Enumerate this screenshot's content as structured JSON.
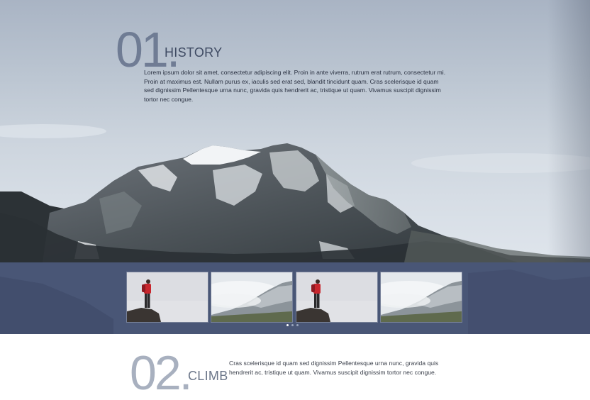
{
  "history": {
    "number": "01.",
    "title": "HISTORY",
    "text": "Lorem ipsum dolor sit amet, consectetur adipiscing elit. Proin in ante viverra, rutrum erat rutrum, consectetur mi. Proin at maximus est. Nullam purus ex, iaculis sed erat sed, blandit tincidunt quam. Cras scelerisque id quam sed dignissim Pellentesque urna nunc, gravida quis hendrerit ac, tristique ut quam. Vivamus suscipit dignissim tortor nec congue."
  },
  "gallery": {
    "thumbnails": [
      {
        "subject": "hiker-on-rock"
      },
      {
        "subject": "misty-mountains"
      },
      {
        "subject": "hiker-on-rock"
      },
      {
        "subject": "misty-mountains"
      }
    ],
    "pagination": {
      "count": 3,
      "active": 1
    }
  },
  "climb": {
    "number": "02.",
    "title": "CLIMB",
    "text": "Cras scelerisque id quam sed dignissim Pellentesque urna nunc, gravida quis hendrerit ac, tristique ut quam. Vivamus suscipit dignissim tortor nec congue."
  },
  "colors": {
    "accent_dark": "#4c5875",
    "title_text": "#3e4a62",
    "number_text": "#6a7790"
  }
}
